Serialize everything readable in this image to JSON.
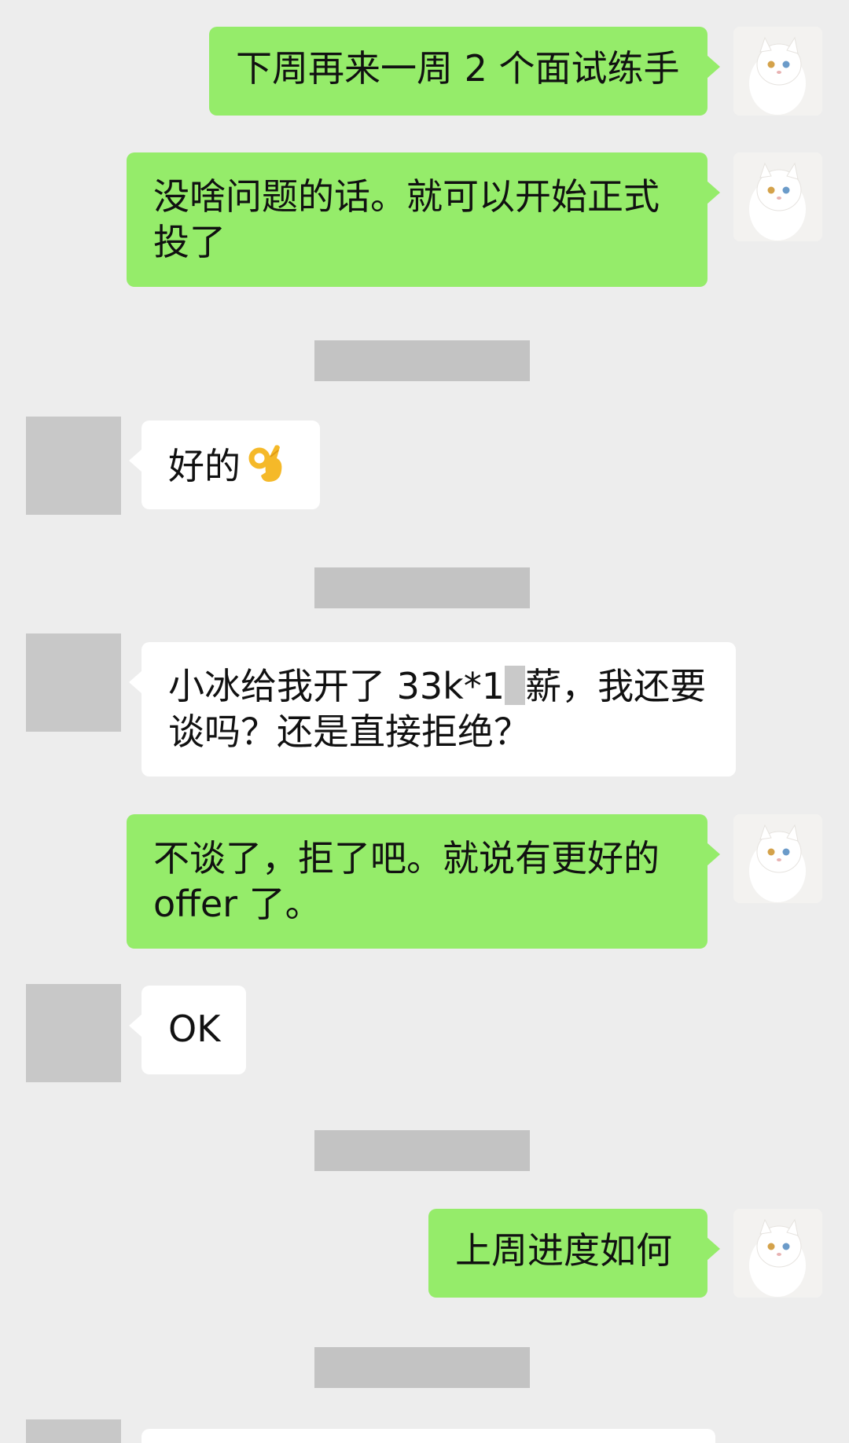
{
  "messages": [
    {
      "id": "m1",
      "sender": "me",
      "text": "下周再来一周 2 个面试练手"
    },
    {
      "id": "m2",
      "sender": "me",
      "text": "没啥问题的话。就可以开始正式\n投了"
    },
    {
      "id": "m3",
      "sender": "other",
      "text": "好的",
      "emoji": "ok-hand"
    },
    {
      "id": "m4",
      "sender": "other",
      "text_before": "小冰给我开了 33k*1",
      "text_after": "薪，我还要",
      "text_line2": "谈吗？还是直接拒绝？"
    },
    {
      "id": "m5",
      "sender": "me",
      "text": "不谈了，拒了吧。就说有更好的\noffer 了。"
    },
    {
      "id": "m6",
      "sender": "other",
      "text": "OK"
    },
    {
      "id": "m7",
      "sender": "me",
      "text": "上周进度如何"
    }
  ],
  "colors": {
    "background": "#ededed",
    "bubble_me": "#95ec6a",
    "bubble_other": "#ffffff",
    "redaction": "#c3c3c3"
  },
  "icons": {
    "my_avatar": "white-cat-avatar",
    "ok_emoji": "ok-hand-emoji"
  }
}
